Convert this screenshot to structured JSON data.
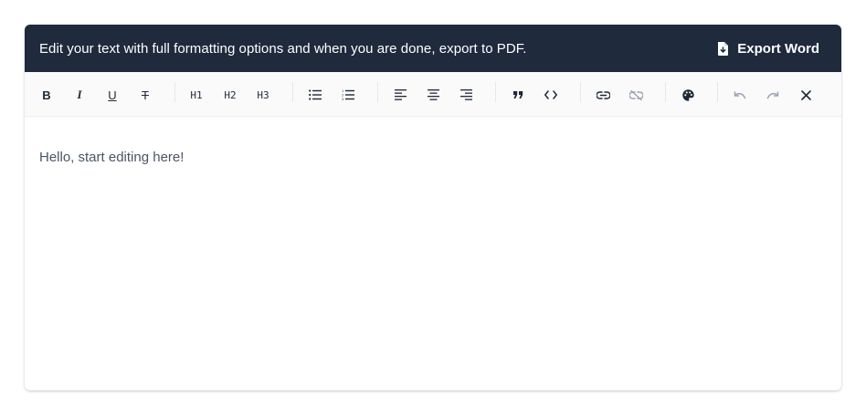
{
  "header": {
    "text": "Edit your text with full formatting options and when you are done, export to PDF.",
    "export_label": "Export Word",
    "export_icon": "file-download-icon",
    "background": "#1f2a3c"
  },
  "toolbar": {
    "buttons": [
      {
        "name": "bold",
        "label": "B"
      },
      {
        "name": "italic",
        "label": "I"
      },
      {
        "name": "underline",
        "label": "U"
      },
      {
        "name": "strikethrough",
        "label": "T"
      },
      {
        "name": "heading-1",
        "label": "H1"
      },
      {
        "name": "heading-2",
        "label": "H2"
      },
      {
        "name": "heading-3",
        "label": "H3"
      },
      {
        "name": "bullet-list",
        "icon": "bullet-list-icon"
      },
      {
        "name": "numbered-list",
        "icon": "numbered-list-icon"
      },
      {
        "name": "align-left",
        "icon": "align-left-icon"
      },
      {
        "name": "align-center",
        "icon": "align-center-icon"
      },
      {
        "name": "align-right",
        "icon": "align-right-icon"
      },
      {
        "name": "blockquote",
        "icon": "quote-icon"
      },
      {
        "name": "code",
        "icon": "code-icon"
      },
      {
        "name": "link",
        "icon": "link-icon"
      },
      {
        "name": "unlink",
        "icon": "unlink-icon",
        "disabled": true
      },
      {
        "name": "text-color",
        "icon": "palette-icon"
      },
      {
        "name": "undo",
        "icon": "undo-icon",
        "disabled": true
      },
      {
        "name": "redo",
        "icon": "redo-icon",
        "disabled": true
      },
      {
        "name": "clear",
        "icon": "close-icon"
      }
    ]
  },
  "editor": {
    "content": "Hello, start editing here!"
  }
}
